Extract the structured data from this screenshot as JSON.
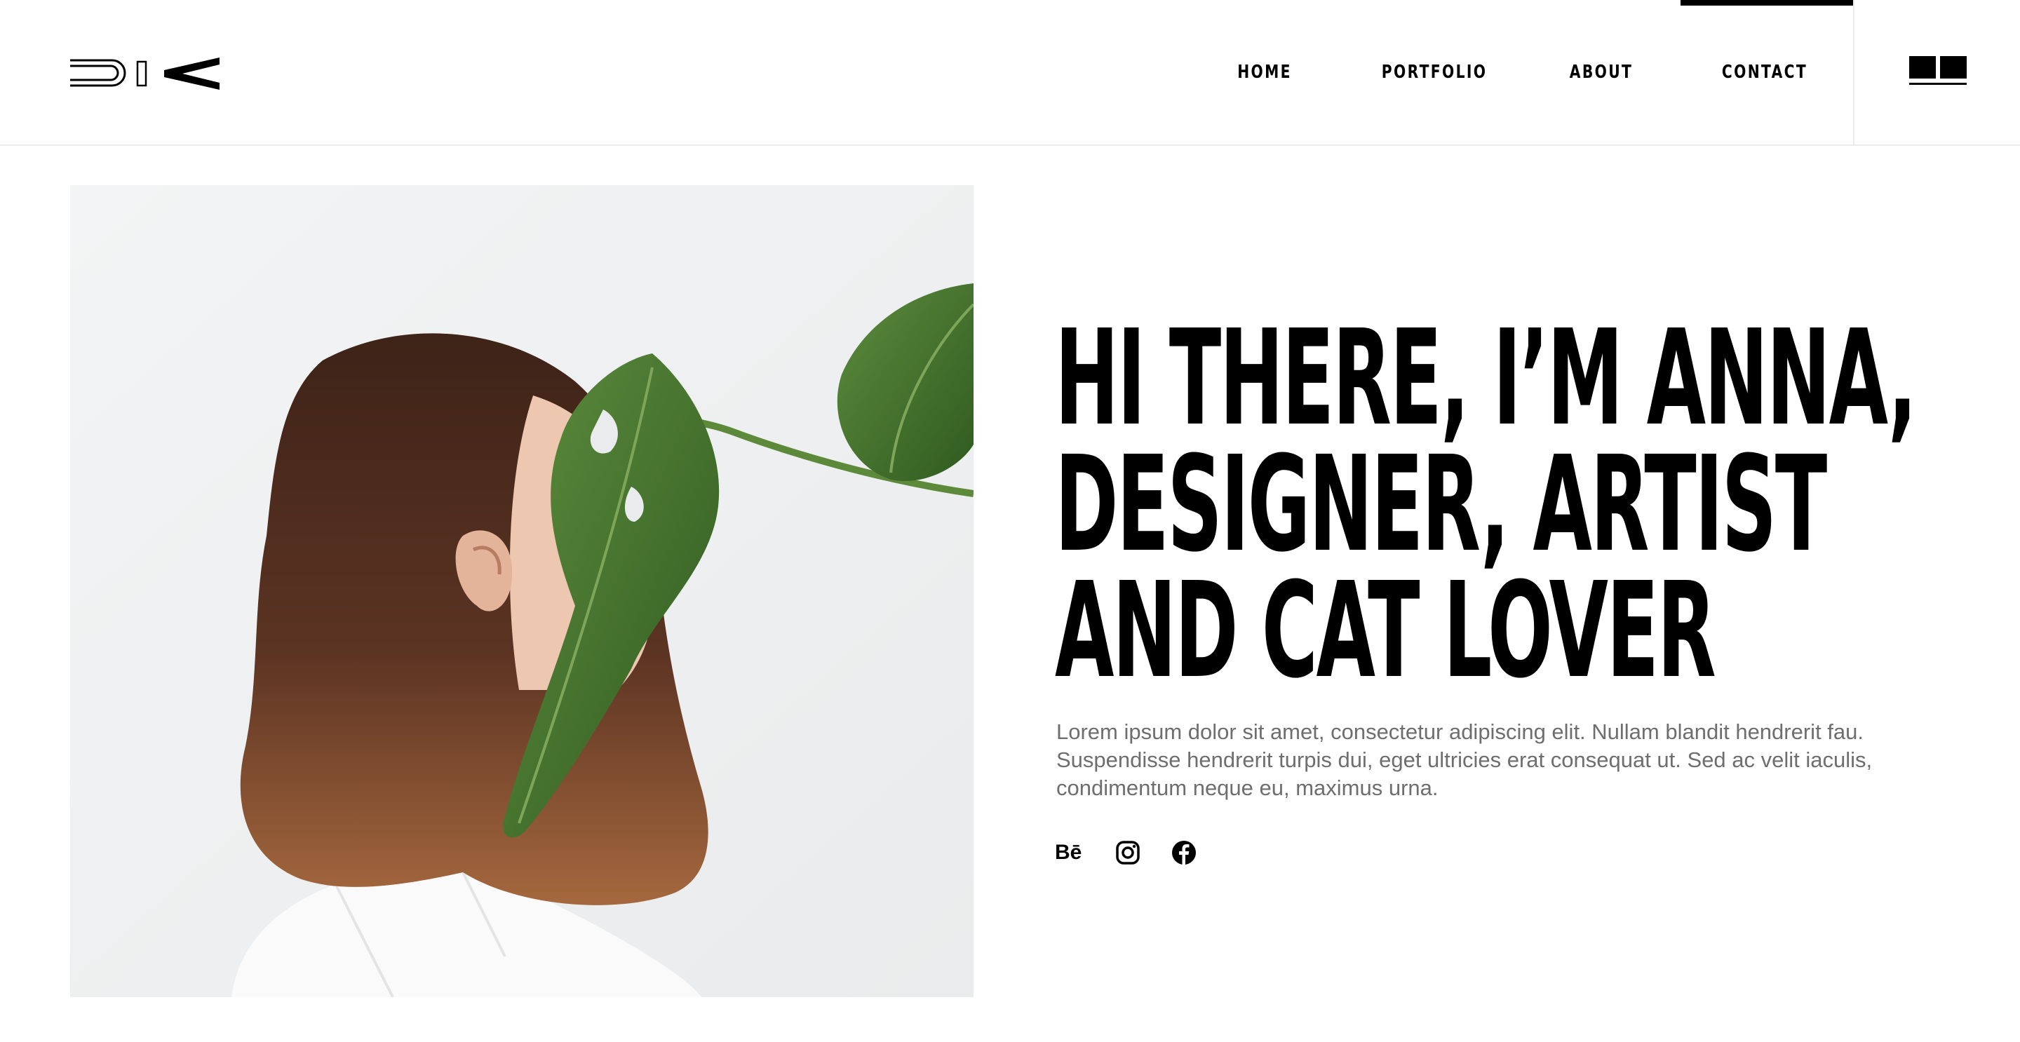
{
  "nav": {
    "items": [
      {
        "label": "HOME"
      },
      {
        "label": "PORTFOLIO"
      },
      {
        "label": "ABOUT"
      },
      {
        "label": "CONTACT",
        "active": true
      }
    ]
  },
  "logo": {
    "icon": "dia-logo-icon"
  },
  "menu": {
    "icon": "menu-icon"
  },
  "hero": {
    "headline": "HI THERE, I’M ANNA,\nDESIGNER, ARTIST\nAND CAT LOVER",
    "intro": "Lorem ipsum dolor sit amet, consectetur adipiscing elit. Nullam blandit hendrerit fau. Suspendisse hendrerit turpis dui, eget ultricies erat consequat ut. Sed ac velit iaculis, condimentum neque eu, maximus urna.",
    "social": [
      {
        "label": "Bē",
        "icon": "behance-icon"
      },
      {
        "icon": "instagram-icon"
      },
      {
        "icon": "facebook-icon"
      }
    ]
  },
  "colors": {
    "text": "#000000",
    "muted": "#6e6e6e",
    "background": "#ffffff",
    "divider": "#ececec"
  }
}
